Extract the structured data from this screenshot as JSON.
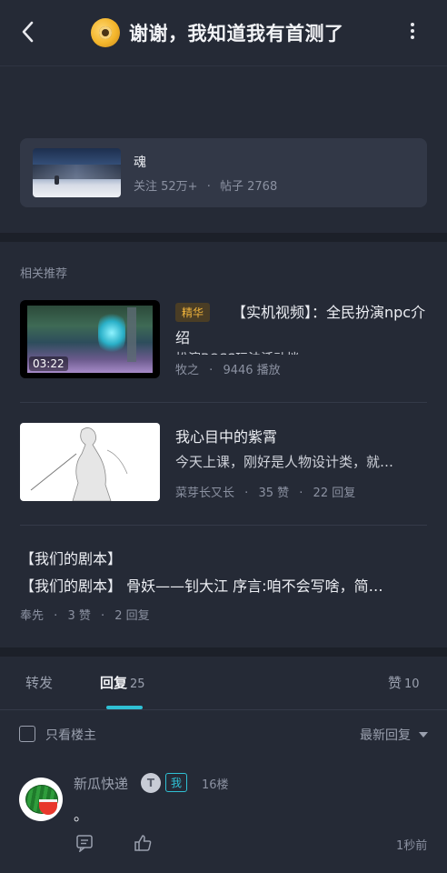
{
  "header": {
    "title": "谢谢，我知道我有首测了",
    "back_icon": "chevron-left-icon",
    "more_icon": "more-vertical-icon"
  },
  "forum": {
    "name": "魂",
    "followers": "关注 52万+",
    "separator": "·",
    "posts": "帖子 2768"
  },
  "related": {
    "label": "相关推荐",
    "items": [
      {
        "badge": "精华",
        "title": "【实机视频】：全民扮演npc介绍",
        "duration": "03:22",
        "author": "牧之",
        "plays": "9446 播放",
        "clipped_text": "扮演BOSS玩法活动档、…"
      },
      {
        "title": "我心目中的紫霄",
        "subtitle": "今天上课，刚好是人物设计类，就…",
        "author": "菜芽长又长",
        "likes": "35 赞",
        "replies": "22 回复"
      },
      {
        "title": "【我们的剧本】",
        "subtitle": "【我们的剧本】 骨妖——钊大江 序言:咱不会写啥，简…",
        "author": "奉先",
        "likes": "3 赞",
        "replies": "2 回复"
      }
    ]
  },
  "tabs": {
    "forward": "转发",
    "reply": "回复",
    "reply_count": "25",
    "like": "赞",
    "like_count": "10"
  },
  "filter": {
    "only_op": "只看楼主",
    "sort": "最新回复"
  },
  "comment": {
    "author": "新瓜快递",
    "level": "T",
    "me_badge": "我",
    "floor": "16楼",
    "text": "。",
    "time": "1秒前"
  },
  "colors": {
    "background": "#252a36",
    "card": "#323847",
    "accent": "#2fc0d4",
    "badge": "#f0b43c"
  }
}
